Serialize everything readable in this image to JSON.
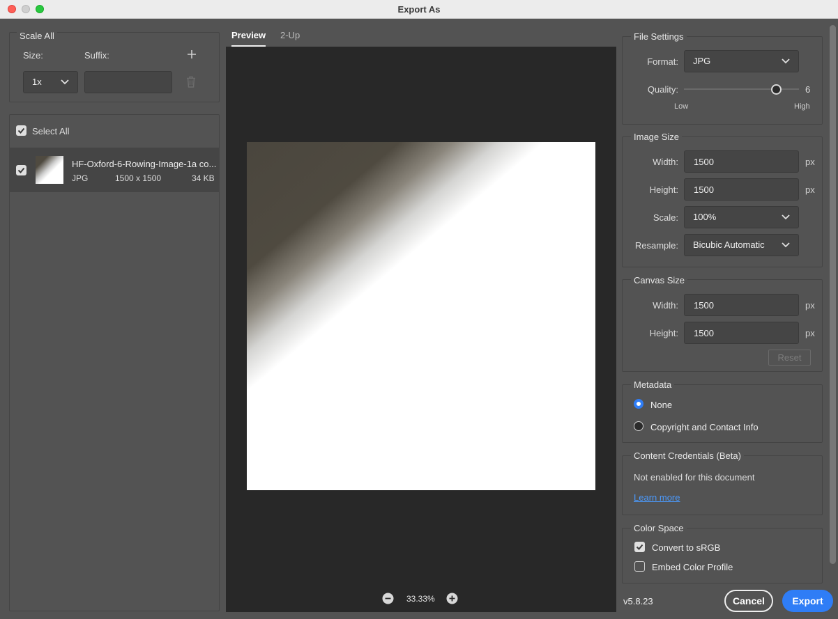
{
  "window": {
    "title": "Export As"
  },
  "scale_all": {
    "title": "Scale All",
    "size_label": "Size:",
    "suffix_label": "Suffix:",
    "size_value": "1x",
    "suffix_value": ""
  },
  "assets": {
    "select_all_label": "Select All",
    "items": [
      {
        "name": "HF-Oxford-6-Rowing-Image-1a co...",
        "format": "JPG",
        "dimensions": "1500 x 1500",
        "size": "34 KB"
      }
    ]
  },
  "preview": {
    "tabs": [
      "Preview",
      "2-Up"
    ],
    "active_tab": "Preview",
    "zoom": "33.33%"
  },
  "file_settings": {
    "title": "File Settings",
    "format_label": "Format:",
    "format_value": "JPG",
    "quality_label": "Quality:",
    "quality_value": "6",
    "quality_level": 0.8,
    "quality_low": "Low",
    "quality_high": "High"
  },
  "image_size": {
    "title": "Image Size",
    "width_label": "Width:",
    "width_value": "1500",
    "height_label": "Height:",
    "height_value": "1500",
    "unit": "px",
    "scale_label": "Scale:",
    "scale_value": "100%",
    "resample_label": "Resample:",
    "resample_value": "Bicubic Automatic"
  },
  "canvas_size": {
    "title": "Canvas Size",
    "width_label": "Width:",
    "width_value": "1500",
    "height_label": "Height:",
    "height_value": "1500",
    "unit": "px",
    "reset_label": "Reset"
  },
  "metadata": {
    "title": "Metadata",
    "options": [
      "None",
      "Copyright and Contact Info"
    ],
    "selected": "None"
  },
  "content_credentials": {
    "title": "Content Credentials (Beta)",
    "status": "Not enabled for this document",
    "link": "Learn more"
  },
  "color_space": {
    "title": "Color Space",
    "convert_label": "Convert to sRGB",
    "convert_checked": true,
    "embed_label": "Embed Color Profile",
    "embed_checked": false
  },
  "footer": {
    "version": "v5.8.23",
    "cancel_label": "Cancel",
    "export_label": "Export"
  },
  "colors": {
    "accent": "#2f7df6",
    "panel": "#535353",
    "preview_bg": "#282828"
  }
}
